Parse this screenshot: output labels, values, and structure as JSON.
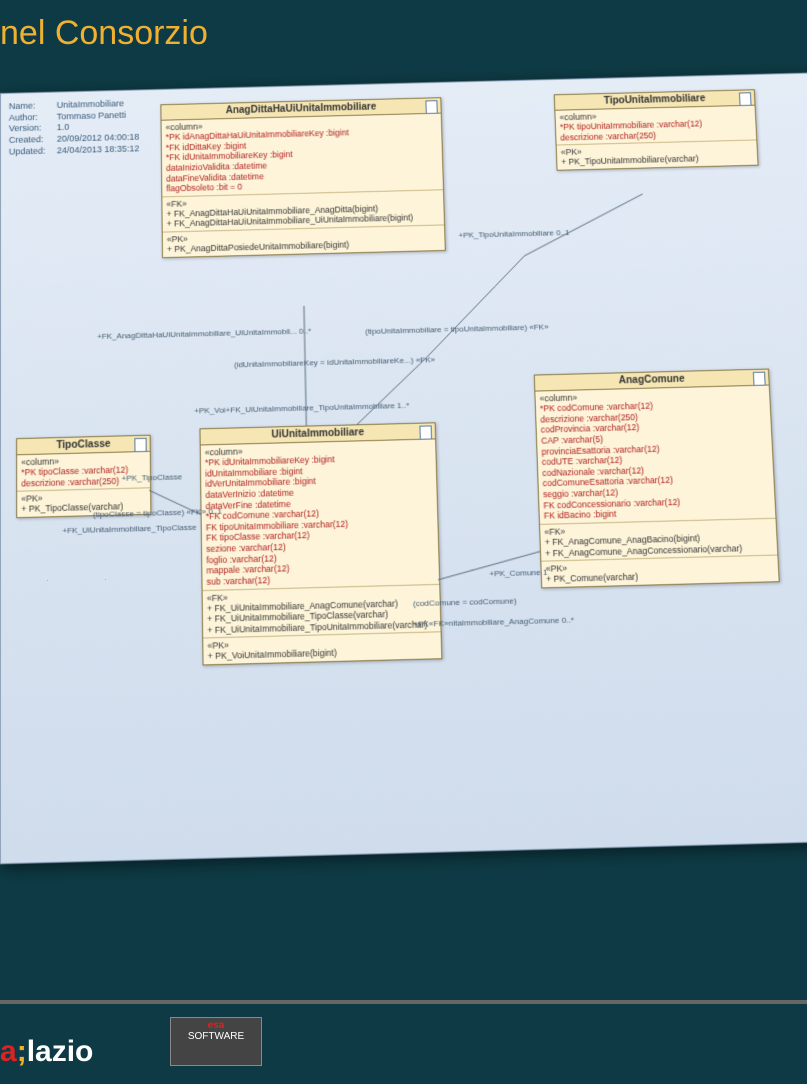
{
  "slide_title": "nel Consorzio",
  "brand": {
    "part1": "a",
    "part2": ";",
    "part3": "lazio"
  },
  "esa_logo": {
    "line1": "esa",
    "line2": "SOFTWARE"
  },
  "canvas_meta": {
    "name_label": "Name:",
    "name": "UnitaImmobiliare",
    "author_label": "Author:",
    "author": "Tommaso Panetti",
    "version_label": "Version:",
    "version": "1.0",
    "created_label": "Created:",
    "created": "20/09/2012 04:00:18",
    "updated_label": "Updated:",
    "updated": "24/04/2013 18:35:12"
  },
  "boxes": {
    "anagDitta": {
      "title": "AnagDittaHaUiUnitaImmobiliare",
      "stereo_col": "«column»",
      "cols": [
        "*PK idAnagDittaHaUiUnitaImmobiliareKey :bigint",
        "*FK idDittaKey :bigint",
        "*FK idUnitaImmobiliareKey :bigint",
        "   dataInizioValidita :datetime",
        "   dataFineValidita :datetime",
        "   flagObsoleto :bit = 0"
      ],
      "stereo_fk": "«FK»",
      "fks": [
        "FK_AnagDittaHaUiUnitaImmobiliare_AnagDitta(bigint)",
        "FK_AnagDittaHaUiUnitaImmobiliare_UiUnitaImmobiliare(bigint)"
      ],
      "stereo_pk": "«PK»",
      "pks": [
        "PK_AnagDittaPosiedeUnitaImmobiliare(bigint)"
      ]
    },
    "tipoUnita": {
      "title": "TipoUnitaImmobiliare",
      "stereo_col": "«column»",
      "cols": [
        "*PK tipoUnitaImmobiliare :varchar(12)",
        "   descrizione :varchar(250)"
      ],
      "stereo_pk": "«PK»",
      "pks": [
        "PK_TipoUnitaImmobiliare(varchar)"
      ]
    },
    "tipoClasse": {
      "title": "TipoClasse",
      "stereo_col": "«column»",
      "cols": [
        "*PK tipoClasse :varchar(12)",
        "   descrizione :varchar(250)"
      ],
      "stereo_pk": "«PK»",
      "pks": [
        "PK_TipoClasse(varchar)"
      ]
    },
    "uiUnita": {
      "title": "UiUnitaImmobiliare",
      "stereo_col": "«column»",
      "cols": [
        "*PK idUnitaImmobiliareKey :bigint",
        "   idUnitaImmobiliare :bigint",
        "   idVerUnitaImmobiliare :bigint",
        "   dataVerInizio :datetime",
        "   dataVerFine :datetime",
        "*FK codComune :varchar(12)",
        " FK tipoUnitaImmobiliare :varchar(12)",
        " FK tipoClasse :varchar(12)",
        "   sezione :varchar(12)",
        "   foglio :varchar(12)",
        "   mappale :varchar(12)",
        "   sub :varchar(12)"
      ],
      "stereo_fk": "«FK»",
      "fks": [
        "FK_UiUnitaImmobiliare_AnagComune(varchar)",
        "FK_UiUnitaImmobiliare_TipoClasse(varchar)",
        "FK_UiUnitaImmobiliare_TipoUnitaImmobiliare(varchar)"
      ],
      "stereo_pk": "«PK»",
      "pks": [
        "PK_VoiUnitaImmobiliare(bigint)"
      ]
    },
    "anagComune": {
      "title": "AnagComune",
      "stereo_col": "«column»",
      "cols": [
        "*PK codComune :varchar(12)",
        "   descrizione :varchar(250)",
        "   codProvincia :varchar(12)",
        "   CAP :varchar(5)",
        "   provinciaEsattoria :varchar(12)",
        "   codUTE :varchar(12)",
        "   codNazionale :varchar(12)",
        "   codComuneEsattoria :varchar(12)",
        "   seggio :varchar(12)",
        " FK codConcessionario :varchar(12)",
        " FK idBacino :bigint"
      ],
      "stereo_fk": "«FK»",
      "fks": [
        "FK_AnagComune_AnagBacino(bigint)",
        "FK_AnagComune_AnagConcessionario(varchar)"
      ],
      "stereo_pk": "«PK»",
      "pks": [
        "PK_Comune(varchar)"
      ]
    }
  },
  "links": {
    "l1_label": "+FK_AnagDittaHaUiUnitaImmobiliare_UiUnitaImmobil...   0..*",
    "l1_note": "(idUnitaImmobiliareKey = idUnitaImmobiliareKe...)   «FK»",
    "l2_label": "+PK_TipoUnitaImmobiliare   0..1",
    "l2_note": "(tipoUnitaImmobiliare = tipoUnitaImmobiliare)   «FK»",
    "l3_label": "+PK_Voi+FK_UiUnitaImmobiliare_TipoUnitaImmobiliare  1..*",
    "l4_label": "+PK_TipoClasse",
    "l4_note": "(tipoClasse = tipoClasse)   «FK»   0..1",
    "l4_extra": "+FK_UiUnitaImmobiliare_TipoClasse",
    "l5_label": "+PK_Comune  1",
    "l5_note": "(codComune = codComune)",
    "l5_extra": "+FK«FK»nitaImmobiliare_AnagComune   0..*"
  }
}
